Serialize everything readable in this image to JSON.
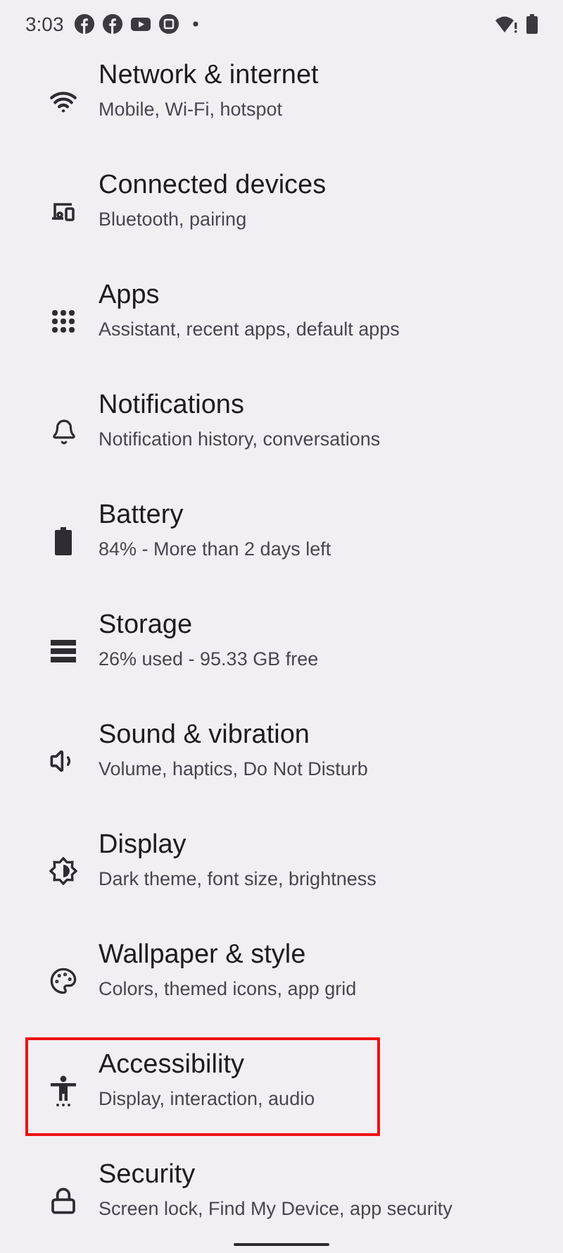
{
  "status_bar": {
    "time": "3:03"
  },
  "settings": [
    {
      "title": "Network & internet",
      "subtitle": "Mobile, Wi-Fi, hotspot",
      "highlighted": false
    },
    {
      "title": "Connected devices",
      "subtitle": "Bluetooth, pairing",
      "highlighted": false
    },
    {
      "title": "Apps",
      "subtitle": "Assistant, recent apps, default apps",
      "highlighted": false
    },
    {
      "title": "Notifications",
      "subtitle": "Notification history, conversations",
      "highlighted": false
    },
    {
      "title": "Battery",
      "subtitle": "84% - More than 2 days left",
      "highlighted": false
    },
    {
      "title": "Storage",
      "subtitle": "26% used - 95.33 GB free",
      "highlighted": false
    },
    {
      "title": "Sound & vibration",
      "subtitle": "Volume, haptics, Do Not Disturb",
      "highlighted": false
    },
    {
      "title": "Display",
      "subtitle": "Dark theme, font size, brightness",
      "highlighted": false
    },
    {
      "title": "Wallpaper & style",
      "subtitle": "Colors, themed icons, app grid",
      "highlighted": false
    },
    {
      "title": "Accessibility",
      "subtitle": "Display, interaction, audio",
      "highlighted": true
    },
    {
      "title": "Security",
      "subtitle": "Screen lock, Find My Device, app security",
      "highlighted": false
    }
  ]
}
